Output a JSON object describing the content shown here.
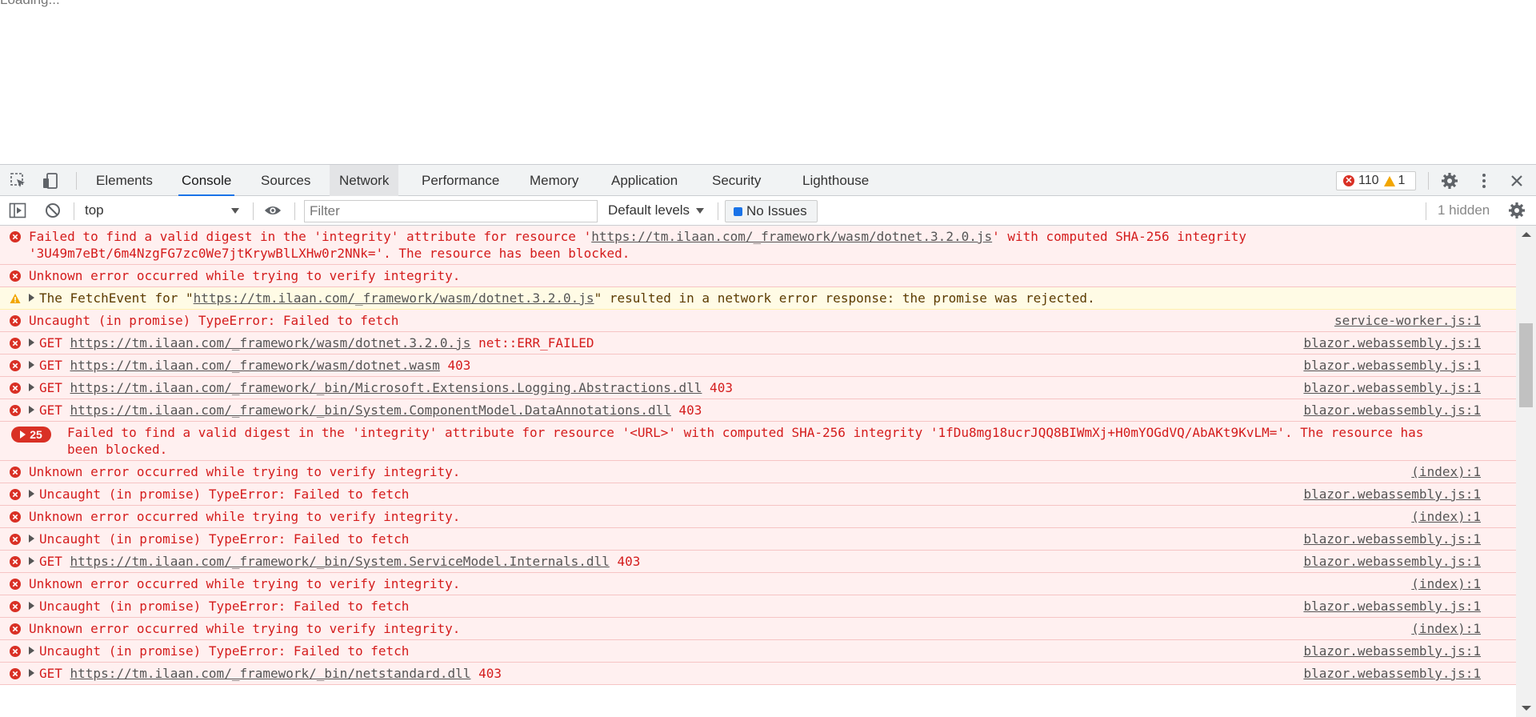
{
  "page": {
    "loading_text": "Loading..."
  },
  "devtools": {
    "tabs": [
      "Elements",
      "Console",
      "Sources",
      "Network",
      "Performance",
      "Memory",
      "Application",
      "Security",
      "Lighthouse"
    ],
    "active_tab": "Console",
    "error_count": "110",
    "warning_count": "1",
    "toolbar": {
      "context": "top",
      "filter_placeholder": "Filter",
      "levels": "Default levels",
      "issues": "No Issues",
      "hidden": "1 hidden"
    }
  },
  "messages": [
    {
      "level": "error",
      "parts": [
        "Failed to find a valid digest in the 'integrity' attribute for resource '",
        {
          "link": "https://tm.ilaan.com/_framework/wasm/dotnet.3.2.0.js"
        },
        "' with computed SHA-256 integrity\n'3U49m7eBt/6m4NzgFG7zc0We7jtKrywBlLXHw0r2NNk='. The resource has been blocked."
      ],
      "source": ""
    },
    {
      "level": "error",
      "parts": [
        "Unknown error occurred while trying to verify integrity."
      ],
      "source": ""
    },
    {
      "level": "warning",
      "expandable": true,
      "parts": [
        "The FetchEvent for \"",
        {
          "link": "https://tm.ilaan.com/_framework/wasm/dotnet.3.2.0.js"
        },
        "\" resulted in a network error response: the promise was rejected."
      ],
      "source": ""
    },
    {
      "level": "error",
      "parts": [
        "Uncaught (in promise) TypeError: Failed to fetch"
      ],
      "source": "service-worker.js:1"
    },
    {
      "level": "error",
      "expandable": true,
      "parts": [
        "GET ",
        {
          "link": "https://tm.ilaan.com/_framework/wasm/dotnet.3.2.0.js"
        },
        " net::ERR_FAILED"
      ],
      "source": "blazor.webassembly.js:1"
    },
    {
      "level": "error",
      "expandable": true,
      "parts": [
        "GET ",
        {
          "link": "https://tm.ilaan.com/_framework/wasm/dotnet.wasm"
        },
        " 403"
      ],
      "source": "blazor.webassembly.js:1"
    },
    {
      "level": "error",
      "expandable": true,
      "parts": [
        "GET ",
        {
          "link": "https://tm.ilaan.com/_framework/_bin/Microsoft.Extensions.Logging.Abstractions.dll"
        },
        " 403"
      ],
      "source": "blazor.webassembly.js:1"
    },
    {
      "level": "error",
      "expandable": true,
      "parts": [
        "GET ",
        {
          "link": "https://tm.ilaan.com/_framework/_bin/System.ComponentModel.DataAnnotations.dll"
        },
        " 403"
      ],
      "source": "blazor.webassembly.js:1"
    },
    {
      "level": "error",
      "repeat": "25",
      "parts": [
        "Failed to find a valid digest in the 'integrity' attribute for resource '<URL>' with computed SHA-256 integrity '1fDu8mg18ucrJQQ8BIWmXj+H0mYOGdVQ/AbAKt9KvLM='. The resource has\nbeen blocked."
      ],
      "source": ""
    },
    {
      "level": "error",
      "parts": [
        "Unknown error occurred while trying to verify integrity."
      ],
      "source": "(index):1"
    },
    {
      "level": "error",
      "expandable": true,
      "parts": [
        "Uncaught (in promise) TypeError: Failed to fetch"
      ],
      "source": "blazor.webassembly.js:1"
    },
    {
      "level": "error",
      "parts": [
        "Unknown error occurred while trying to verify integrity."
      ],
      "source": "(index):1"
    },
    {
      "level": "error",
      "expandable": true,
      "parts": [
        "Uncaught (in promise) TypeError: Failed to fetch"
      ],
      "source": "blazor.webassembly.js:1"
    },
    {
      "level": "error",
      "expandable": true,
      "parts": [
        "GET ",
        {
          "link": "https://tm.ilaan.com/_framework/_bin/System.ServiceModel.Internals.dll"
        },
        " 403"
      ],
      "source": "blazor.webassembly.js:1"
    },
    {
      "level": "error",
      "parts": [
        "Unknown error occurred while trying to verify integrity."
      ],
      "source": "(index):1"
    },
    {
      "level": "error",
      "expandable": true,
      "parts": [
        "Uncaught (in promise) TypeError: Failed to fetch"
      ],
      "source": "blazor.webassembly.js:1"
    },
    {
      "level": "error",
      "parts": [
        "Unknown error occurred while trying to verify integrity."
      ],
      "source": "(index):1"
    },
    {
      "level": "error",
      "expandable": true,
      "parts": [
        "Uncaught (in promise) TypeError: Failed to fetch"
      ],
      "source": "blazor.webassembly.js:1"
    },
    {
      "level": "error",
      "expandable": true,
      "parts": [
        "GET ",
        {
          "link": "https://tm.ilaan.com/_framework/_bin/netstandard.dll"
        },
        " 403"
      ],
      "source": "blazor.webassembly.js:1"
    }
  ]
}
